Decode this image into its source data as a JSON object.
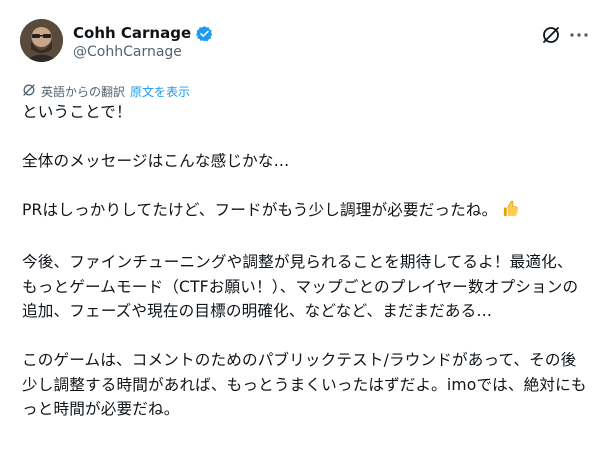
{
  "author": {
    "display_name": "Cohh Carnage",
    "handle": "@CohhCarnage"
  },
  "icons": {
    "verified": "verified-badge-icon",
    "grok": "grok-icon",
    "more": "more-horizontal-icon",
    "translate": "translate-icon",
    "thumbs_up": "thumbs-up-emoji"
  },
  "translation": {
    "label": "英語からの翻訳",
    "show_original": "原文を表示"
  },
  "post": {
    "paragraphs": [
      "ということで！",
      "全体のメッセージはこんな感じかな…",
      "PRはしっかりしてたけど、フードがもう少し調理が必要だったね。",
      "今後、ファインチューニングや調整が見られることを期待してるよ！最適化、もっとゲームモード（CTFお願い！）、マップごとのプレイヤー数オプションの追加、フェーズや現在の目標の明確化、などなど、まだまだある…",
      "このゲームは、コメントのためのパブリックテスト/ラウンドがあって、その後少し調整する時間があれば、もっとうまくいったはずだよ。imoでは、絶対にもっと時間が必要だね。"
    ]
  },
  "colors": {
    "accent": "#1d9bf0",
    "text": "#0f1419",
    "secondary": "#536471"
  }
}
